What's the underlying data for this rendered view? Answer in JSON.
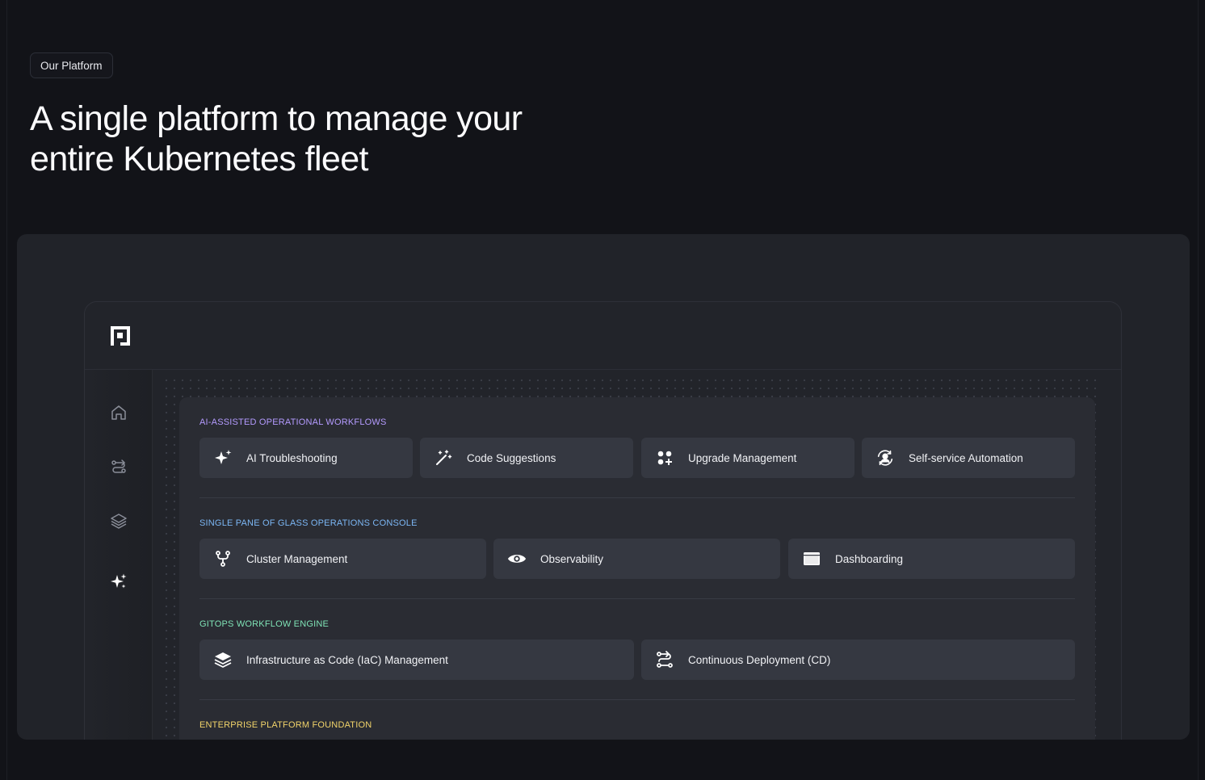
{
  "eyebrow": "Our Platform",
  "headline": {
    "line1": "A single platform to manage your",
    "line2": "entire Kubernetes fleet"
  },
  "sidebar": {
    "items": [
      {
        "icon": "home-icon"
      },
      {
        "icon": "workflow-icon"
      },
      {
        "icon": "layers-icon"
      },
      {
        "icon": "sparkles-icon",
        "active": true
      }
    ]
  },
  "sections": [
    {
      "title": "AI-ASSISTED OPERATIONAL WORKFLOWS",
      "color": "#b49bff",
      "tiles": [
        {
          "label": "AI Troubleshooting",
          "icon": "sparkles-icon"
        },
        {
          "label": "Code Suggestions",
          "icon": "magic-wand-icon"
        },
        {
          "label": "Upgrade Management",
          "icon": "grid-plus-icon"
        },
        {
          "label": "Self-service Automation",
          "icon": "user-sync-icon"
        }
      ]
    },
    {
      "title": "SINGLE PANE OF GLASS OPERATIONS CONSOLE",
      "color": "#7cb7f5",
      "tiles": [
        {
          "label": "Cluster Management",
          "icon": "fork-icon"
        },
        {
          "label": "Observability",
          "icon": "eye-icon"
        },
        {
          "label": "Dashboarding",
          "icon": "window-icon"
        }
      ]
    },
    {
      "title": "GITOPS WORKFLOW ENGINE",
      "color": "#7fe3b6",
      "tiles": [
        {
          "label": "Infrastructure as Code (IaC) Management",
          "icon": "stack-icon"
        },
        {
          "label": "Continuous Deployment (CD)",
          "icon": "route-icon"
        }
      ]
    },
    {
      "title": "ENTERPRISE PLATFORM FOUNDATION",
      "color": "#f2d46a",
      "tiles": []
    }
  ]
}
